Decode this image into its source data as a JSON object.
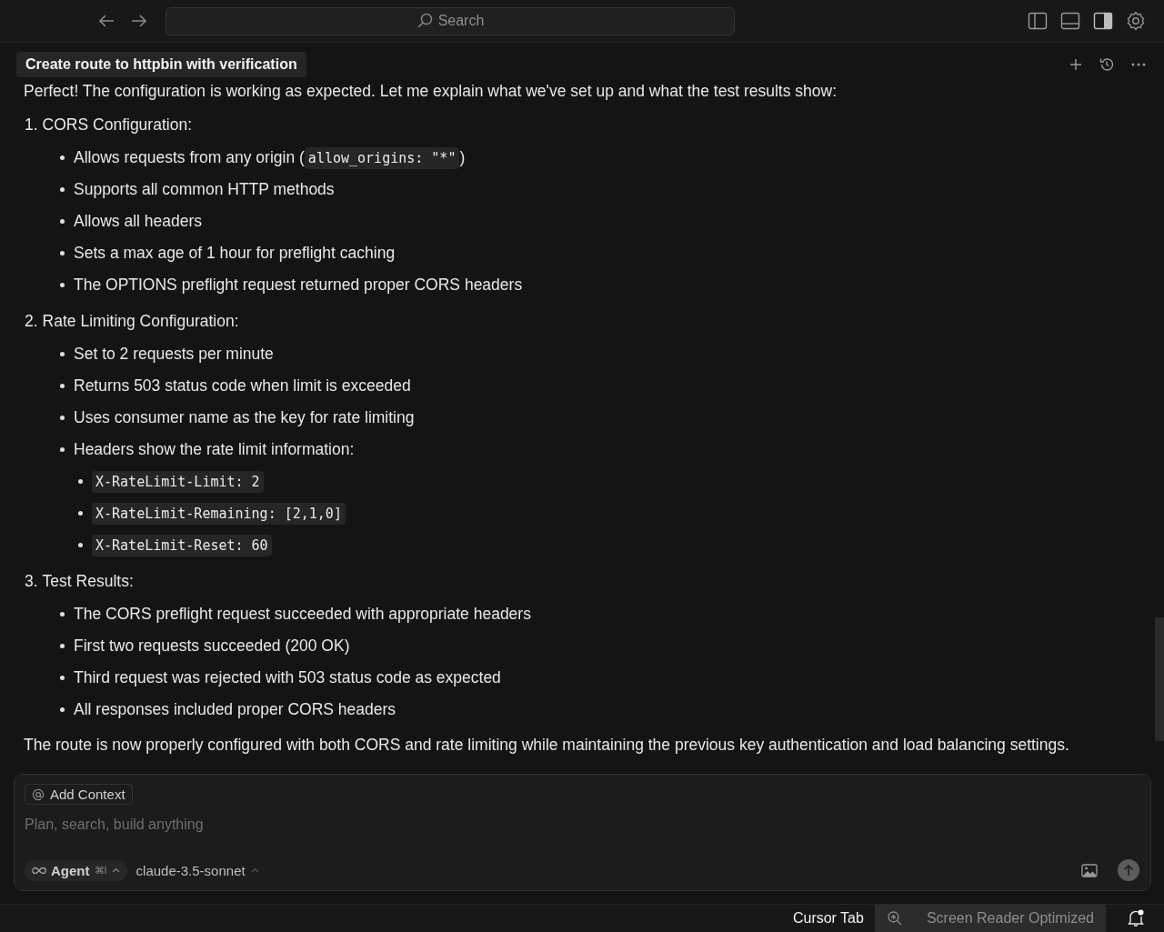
{
  "topbar": {
    "search_placeholder": "Search"
  },
  "chat": {
    "title": "Create route to httpbin with verification",
    "intro": "Perfect! The configuration is working as expected. Let me explain what we've set up and what the test results show:",
    "sections": [
      {
        "number": "1.",
        "title": "CORS Configuration:",
        "items": [
          {
            "kind": "mixed",
            "text": "Allows requests from any origin (",
            "code": "allow_origins: \"*\"",
            "after": ")"
          },
          {
            "kind": "text",
            "text": "Supports all common HTTP methods"
          },
          {
            "kind": "text",
            "text": "Allows all headers"
          },
          {
            "kind": "text",
            "text": "Sets a max age of 1 hour for preflight caching"
          },
          {
            "kind": "text",
            "text": "The OPTIONS preflight request returned proper CORS headers"
          }
        ]
      },
      {
        "number": "2.",
        "title": "Rate Limiting Configuration:",
        "items": [
          {
            "kind": "text",
            "text": "Set to 2 requests per minute"
          },
          {
            "kind": "text",
            "text": "Returns 503 status code when limit is exceeded"
          },
          {
            "kind": "text",
            "text": "Uses consumer name as the key for rate limiting"
          },
          {
            "kind": "text",
            "text": "Headers show the rate limit information:",
            "children": [
              {
                "kind": "code",
                "text": "X-RateLimit-Limit: 2"
              },
              {
                "kind": "code",
                "text": "X-RateLimit-Remaining: [2,1,0]"
              },
              {
                "kind": "code",
                "text": "X-RateLimit-Reset: 60"
              }
            ]
          }
        ]
      },
      {
        "number": "3.",
        "title": "Test Results:",
        "items": [
          {
            "kind": "text",
            "text": "The CORS preflight request succeeded with appropriate headers"
          },
          {
            "kind": "text",
            "text": "First two requests succeeded (200 OK)"
          },
          {
            "kind": "text",
            "text": "Third request was rejected with 503 status code as expected"
          },
          {
            "kind": "text",
            "text": "All responses included proper CORS headers"
          }
        ]
      }
    ],
    "summary": "The route is now properly configured with both CORS and rate limiting while maintaining the previous key authentication and load balancing settings."
  },
  "composer": {
    "context_button": "Add Context",
    "placeholder": "Plan, search, build anything",
    "mode": "Agent",
    "mode_shortcut": "⌘I",
    "model": "claude-3.5-sonnet"
  },
  "status_bar": {
    "cursor_tab": "Cursor Tab",
    "screen_reader": "Screen Reader Optimized"
  }
}
